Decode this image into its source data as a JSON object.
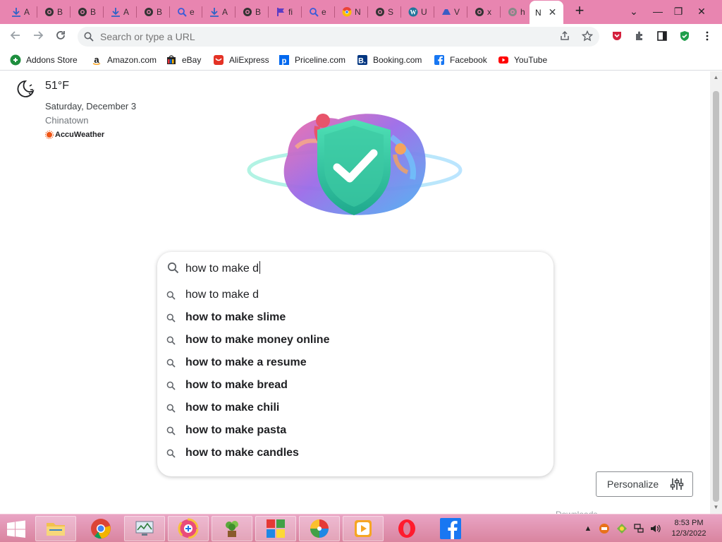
{
  "tabs": [
    {
      "letter": "A",
      "icon": "download-icon",
      "color": "#2f63c6"
    },
    {
      "letter": "B",
      "icon": "globe-icon",
      "color": "#333333"
    },
    {
      "letter": "B",
      "icon": "globe-icon",
      "color": "#333333"
    },
    {
      "letter": "A",
      "icon": "download-icon",
      "color": "#2f63c6"
    },
    {
      "letter": "B",
      "icon": "globe-icon",
      "color": "#333333"
    },
    {
      "letter": "e",
      "icon": "search-icon",
      "color": "#3a5bd8"
    },
    {
      "letter": "A",
      "icon": "download-icon",
      "color": "#2f63c6"
    },
    {
      "letter": "B",
      "icon": "globe-icon",
      "color": "#333333"
    },
    {
      "letter": "fi",
      "icon": "flag-icon",
      "color": "#5b3cc4"
    },
    {
      "letter": "e",
      "icon": "search-icon",
      "color": "#3a5bd8"
    },
    {
      "letter": "N",
      "icon": "chrome-icon",
      "color": "#e94235"
    },
    {
      "letter": "S",
      "icon": "globe-icon",
      "color": "#333333"
    },
    {
      "letter": "U",
      "icon": "wordpress-icon",
      "color": "#21759b"
    },
    {
      "letter": "V",
      "icon": "drive-icon",
      "color": "#3b5cc4"
    },
    {
      "letter": "x",
      "icon": "globe-icon",
      "color": "#333333"
    },
    {
      "letter": "h",
      "icon": "globe-icon",
      "color": "#888888"
    }
  ],
  "active_tab": {
    "letter": "N",
    "close": "✕"
  },
  "window": {
    "new_tab": "+",
    "minimize": "—",
    "restore": "❐",
    "close": "✕",
    "tab_search": "⌄"
  },
  "omnibox": {
    "placeholder": "Search or type a URL"
  },
  "bookmarks": [
    {
      "label": "Addons Store",
      "icon": "addons-icon",
      "color": "#1e8e3e"
    },
    {
      "label": "Amazon.com",
      "icon": "amazon-icon",
      "color": "#ffffff"
    },
    {
      "label": "eBay",
      "icon": "ebay-icon",
      "color": "#ffffff"
    },
    {
      "label": "AliExpress",
      "icon": "aliexpress-icon",
      "color": "#e43225"
    },
    {
      "label": "Priceline.com",
      "icon": "priceline-icon",
      "color": "#0068ef"
    },
    {
      "label": "Booking.com",
      "icon": "booking-icon",
      "color": "#003580"
    },
    {
      "label": "Facebook",
      "icon": "facebook-icon",
      "color": "#1877f2"
    },
    {
      "label": "YouTube",
      "icon": "youtube-icon",
      "color": "#ff0000"
    }
  ],
  "weather": {
    "temp": "51°F",
    "date": "Saturday, December 3",
    "location": "Chinatown",
    "provider": "AccuWeather"
  },
  "search": {
    "query": "how to make d",
    "suggestions": [
      {
        "text": "how to make d",
        "bold": false
      },
      {
        "text": "how to make slime",
        "bold": true
      },
      {
        "text": "how to make money online",
        "bold": true
      },
      {
        "text": "how to make a resume",
        "bold": true
      },
      {
        "text": "how to make bread",
        "bold": true
      },
      {
        "text": "how to make chili",
        "bold": true
      },
      {
        "text": "how to make pasta",
        "bold": true
      },
      {
        "text": "how to make candles",
        "bold": true
      }
    ]
  },
  "personalize": {
    "label": "Personalize"
  },
  "downloads_ghost": "Downloads",
  "clock": {
    "time": "8:53 PM",
    "date": "12/3/2022"
  },
  "colors": {
    "tabstrip": "#e885b0",
    "taskbar": "#d9849f",
    "accent": "#1a73e8"
  }
}
